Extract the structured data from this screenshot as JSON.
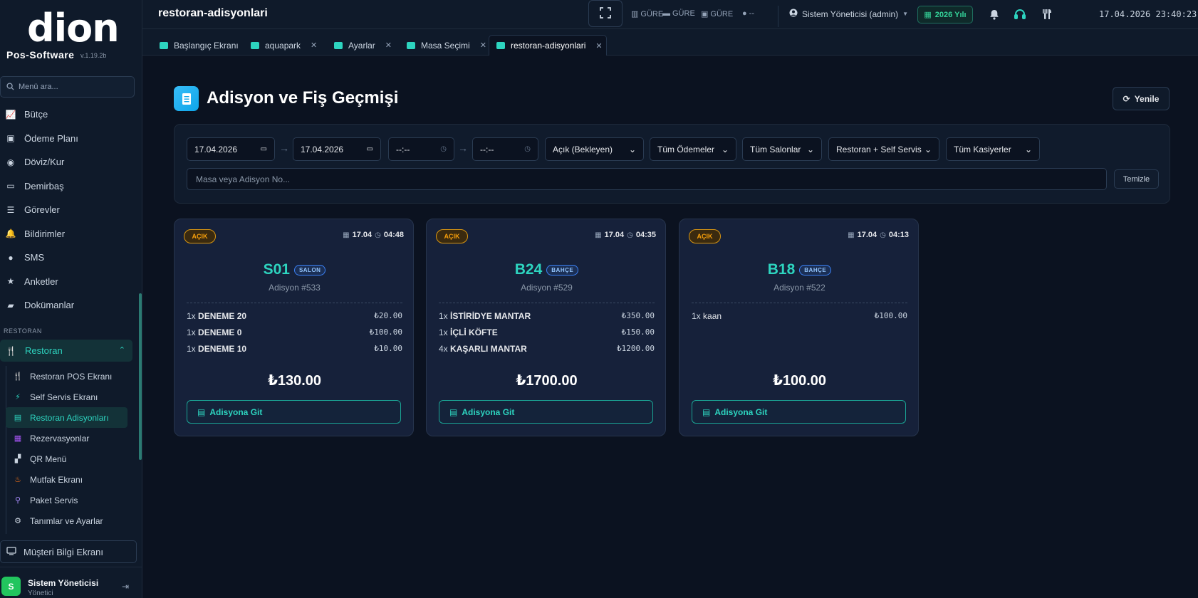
{
  "app": {
    "brand": "dion",
    "product": "Pos-Software",
    "version": "v.1.19.2b"
  },
  "sidebar": {
    "search_placeholder": "Menü ara...",
    "items": [
      {
        "label": "Bütçe",
        "icon": "chart-icon"
      },
      {
        "label": "Ödeme Planı",
        "icon": "calendar-icon"
      },
      {
        "label": "Döviz/Kur",
        "icon": "coins-icon"
      },
      {
        "label": "Demirbaş",
        "icon": "monitor-icon"
      },
      {
        "label": "Görevler",
        "icon": "list-icon"
      },
      {
        "label": "Bildirimler",
        "icon": "bell-icon"
      },
      {
        "label": "SMS",
        "icon": "chat-icon"
      },
      {
        "label": "Anketler",
        "icon": "star-icon"
      },
      {
        "label": "Dokümanlar",
        "icon": "folder-icon"
      }
    ],
    "section": "RESTORAN",
    "restoran_label": "Restoran",
    "sub_items": [
      {
        "label": "Restoran POS Ekranı",
        "icon": "utensils-icon",
        "color": "#cbd5e1"
      },
      {
        "label": "Self Servis Ekranı",
        "icon": "bolt-icon",
        "color": "#2dd4bf"
      },
      {
        "label": "Restoran Adisyonları",
        "icon": "receipt-icon",
        "color": "#2dd4bf",
        "active": true
      },
      {
        "label": "Rezervasyonlar",
        "icon": "calendar-icon",
        "color": "#a855f7"
      },
      {
        "label": "QR Menü",
        "icon": "qr-icon",
        "color": "#cbd5e1"
      },
      {
        "label": "Mutfak Ekranı",
        "icon": "chef-icon",
        "color": "#f97316"
      },
      {
        "label": "Paket Servis",
        "icon": "motorcycle-icon",
        "color": "#a78bfa"
      },
      {
        "label": "Tanımlar ve Ayarlar",
        "icon": "gears-icon",
        "color": "#cbd5e1"
      }
    ],
    "musteri_label": "Müşteri Bilgi Ekranı",
    "user": {
      "initial": "S",
      "name": "Sistem Yöneticisi",
      "role": "Yönetici"
    }
  },
  "header": {
    "title": "restoran-adisyonlari",
    "devices": [
      "GÜRE",
      "GÜRE",
      "GÜRE",
      "--"
    ],
    "user_label": "Sistem Yöneticisi (admin)",
    "year_label": "2026 Yılı",
    "datetime": "17.04.2026 23:40:23"
  },
  "tabs": [
    {
      "label": "Başlangıç Ekranı",
      "closable": false
    },
    {
      "label": "aquapark",
      "closable": true
    },
    {
      "label": "Ayarlar",
      "closable": true
    },
    {
      "label": "Masa Seçimi",
      "closable": true
    },
    {
      "label": "restoran-adisyonlari",
      "closable": true,
      "active": true
    }
  ],
  "main": {
    "title": "Adisyon ve Fiş Geçmişi",
    "refresh_label": "Yenile",
    "filters": {
      "date_from": "17.04.2026",
      "date_to": "17.04.2026",
      "time_from": "--:--",
      "time_to": "--:--",
      "status": "Açık (Bekleyen)",
      "payment": "Tüm Ödemeler",
      "salon": "Tüm Salonlar",
      "service": "Restoran + Self Servis",
      "cashier": "Tüm Kasiyerler",
      "search_placeholder": "Masa veya Adisyon No...",
      "clear_label": "Temizle"
    },
    "cards": [
      {
        "status": "AÇIK",
        "date": "17.04",
        "time": "04:48",
        "table": "S01",
        "area": "SALON",
        "adisyon": "Adisyon #533",
        "items": [
          {
            "qty": "1x",
            "name": "DENEME 20",
            "price": "₺20.00"
          },
          {
            "qty": "1x",
            "name": "DENEME 0",
            "price": "₺100.00"
          },
          {
            "qty": "1x",
            "name": "DENEME 10",
            "price": "₺10.00"
          }
        ],
        "total": "₺130.00",
        "button": "Adisyona Git"
      },
      {
        "status": "AÇIK",
        "date": "17.04",
        "time": "04:35",
        "table": "B24",
        "area": "BAHÇE",
        "adisyon": "Adisyon #529",
        "items": [
          {
            "qty": "1x",
            "name": "İSTİRİDYE MANTAR",
            "price": "₺350.00"
          },
          {
            "qty": "1x",
            "name": "İÇLİ KÖFTE",
            "price": "₺150.00"
          },
          {
            "qty": "4x",
            "name": "KAŞARLI MANTAR",
            "price": "₺1200.00"
          }
        ],
        "total": "₺1700.00",
        "button": "Adisyona Git"
      },
      {
        "status": "AÇIK",
        "date": "17.04",
        "time": "04:13",
        "table": "B18",
        "area": "BAHÇE",
        "adisyon": "Adisyon #522",
        "items": [
          {
            "qty": "1x",
            "name": "kaan",
            "price": "₺100.00"
          }
        ],
        "total": "₺100.00",
        "button": "Adisyona Git"
      }
    ]
  },
  "colors": {
    "accent": "#2dd4bf",
    "warning": "#f59e0b",
    "background": "#0b1220"
  }
}
